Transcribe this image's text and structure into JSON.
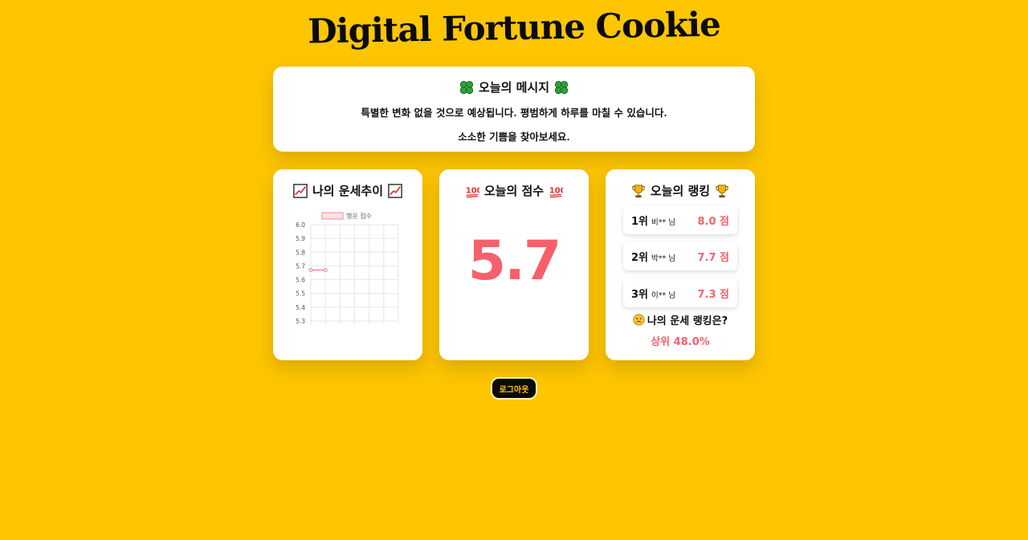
{
  "app": {
    "title": "Digital Fortune Cookie"
  },
  "message": {
    "heading": "오늘의 메시지",
    "lines": [
      "특별한 변화 없을 것으로 예상됩니다. 평범하게 하루를 마칠 수 있습니다.",
      "소소한 기쁨을 찾아보세요."
    ]
  },
  "trend": {
    "heading": "나의 운세추이"
  },
  "chart_data": {
    "type": "line",
    "x": [
      "",
      "",
      "",
      "",
      "",
      "",
      ""
    ],
    "series": [
      {
        "name": "행운 점수",
        "values": [
          5.67,
          5.67
        ]
      }
    ],
    "ylim": [
      5.3,
      6.0
    ],
    "yticks": [
      "6.0",
      "5.9",
      "5.8",
      "5.7",
      "5.6",
      "5.5",
      "5.4",
      "5.3"
    ],
    "grid": true,
    "legend": "top",
    "colors": {
      "line": "#f08a9a",
      "fill": "#fde1e5"
    }
  },
  "score": {
    "heading": "오늘의 점수",
    "value": "5.7"
  },
  "ranking": {
    "heading": "오늘의 랭킹",
    "items": [
      {
        "pos": "1위",
        "name": "비** 님",
        "score": "8.0 점"
      },
      {
        "pos": "2위",
        "name": "박** 님",
        "score": "7.7 점"
      },
      {
        "pos": "3위",
        "name": "이** 님",
        "score": "7.3 점"
      }
    ],
    "my_question": "나의 운세 랭킹은?",
    "my_value": "상위 48.0%"
  },
  "buttons": {
    "logout": "로그아웃"
  },
  "icons": {
    "message": "four-leaf-clover-icon",
    "trend": "chart-increasing-icon",
    "score": "hundred-points-icon",
    "ranking": "trophy-icon",
    "question": "thinking-face-icon"
  },
  "colors": {
    "background": "#fdc601",
    "accent": "#f7606b",
    "button": "#0b0b0b"
  }
}
